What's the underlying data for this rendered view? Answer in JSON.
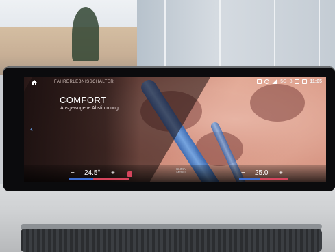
{
  "screen": {
    "section_title": "FAHRERLEBNISSCHALTER",
    "mode_title": "COMFORT",
    "mode_subtitle": "Ausgewogene Abstimmung",
    "status": {
      "network": "5G",
      "sim": "3",
      "time": "11:05"
    },
    "climate_left": {
      "minus": "−",
      "temp": "24.5",
      "unit": "°",
      "plus": "+"
    },
    "climate_right": {
      "minus": "−",
      "temp": "25.0",
      "plus": "+"
    },
    "klima_menu": {
      "line1": "KLIMA",
      "line2": "MENÜ"
    },
    "icons": {
      "home": "home-icon",
      "back": "chevron-left-icon",
      "seat": "seat-heating-icon"
    },
    "colors": {
      "accent_blue": "#6fb0ff",
      "heat_red": "#d6455d"
    }
  }
}
